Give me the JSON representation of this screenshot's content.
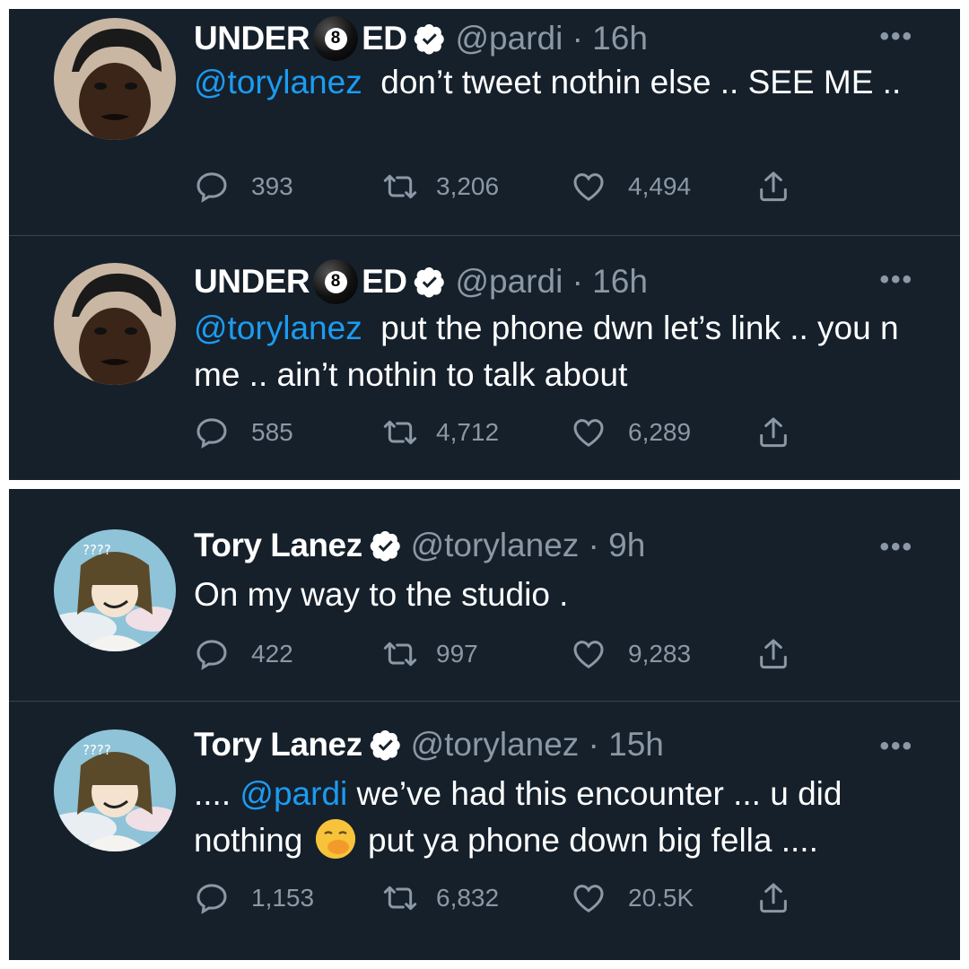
{
  "tweets": [
    {
      "name_part1": "UNDER",
      "name_ball": "8",
      "name_part2": "ED",
      "handle_time": "@pardi · 16h",
      "mention": "@torylanez",
      "text": "  don’t tweet nothin else .. SEE ME ..",
      "replies": "393",
      "retweets": "3,206",
      "likes": "4,494"
    },
    {
      "name_part1": "UNDER",
      "name_ball": "8",
      "name_part2": "ED",
      "handle_time": "@pardi · 16h",
      "mention": "@torylanez",
      "text": "  put the phone dwn let’s link .. you n me .. ain’t nothin to talk about",
      "replies": "585",
      "retweets": "4,712",
      "likes": "6,289"
    },
    {
      "name": "Tory Lanez",
      "handle_time": "@torylanez · 9h",
      "text": "On my way to the studio .",
      "replies": "422",
      "retweets": "997",
      "likes": "9,283"
    },
    {
      "name": "Tory Lanez",
      "handle_time": "@torylanez · 15h",
      "prefix": ".... ",
      "mention": "@pardi",
      "text_a": " we’ve had this encounter ... u did nothing ",
      "text_b": " put ya phone down big fella ....",
      "replies": "1,153",
      "retweets": "6,832",
      "likes": "20.5K"
    }
  ],
  "avatar_text": "????",
  "more_label": "•••",
  "colors": {
    "background": "#15202b",
    "text": "#ffffff",
    "secondary": "#8b98a5",
    "link": "#1d9bf0",
    "verified": "#ffffff"
  }
}
